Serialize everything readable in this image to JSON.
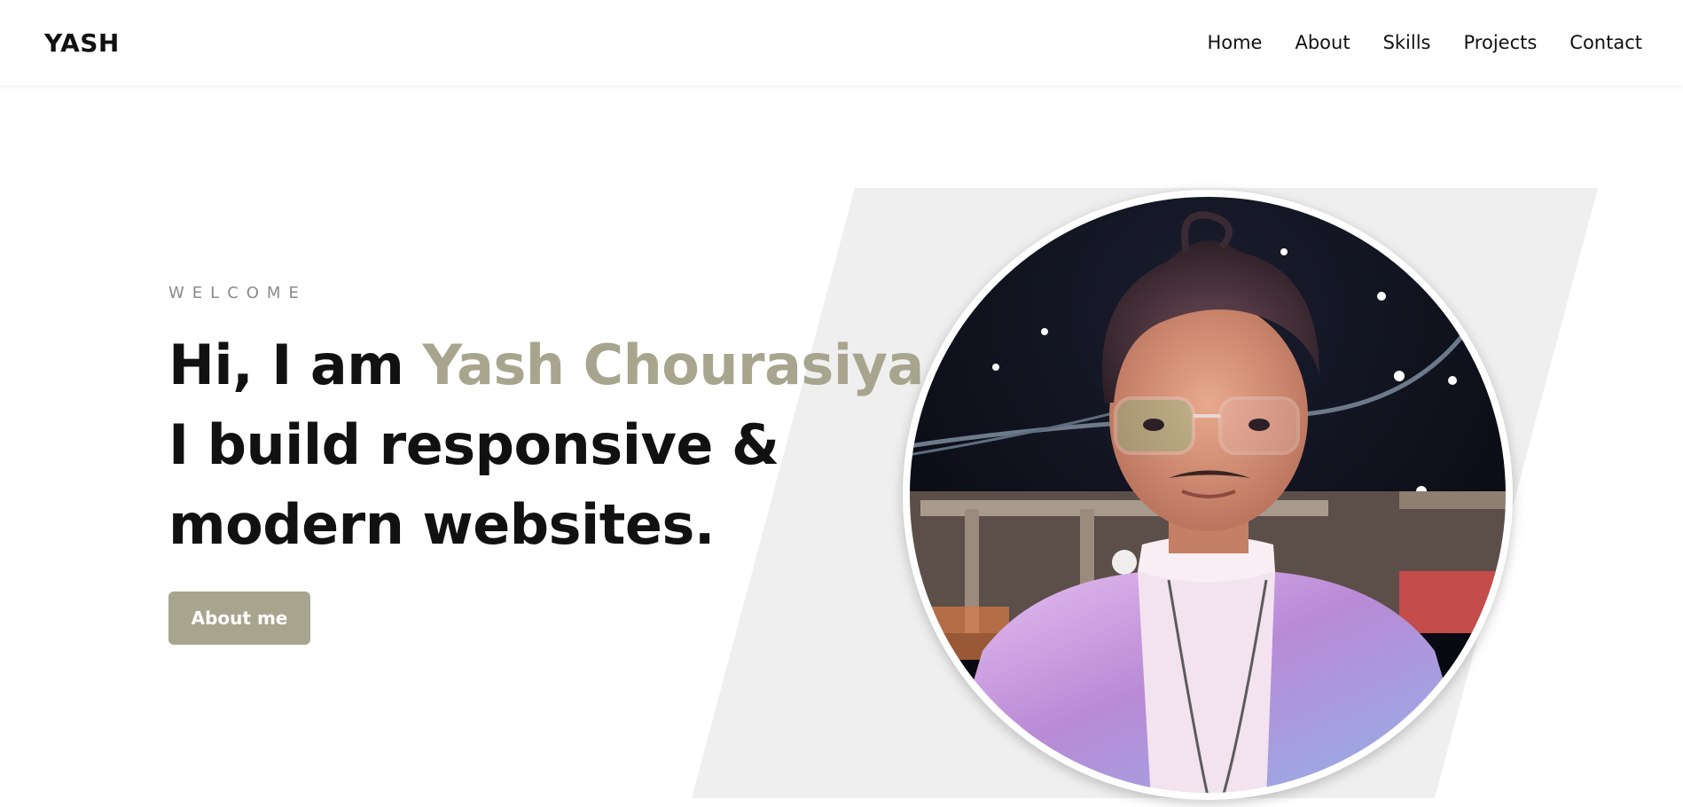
{
  "brand": {
    "logo": "YASH"
  },
  "nav": {
    "items": [
      {
        "label": "Home"
      },
      {
        "label": "About"
      },
      {
        "label": "Skills"
      },
      {
        "label": "Projects"
      },
      {
        "label": "Contact"
      }
    ]
  },
  "hero": {
    "eyebrow": "WELCOME",
    "greeting": "Hi, I am ",
    "name": "Yash Chourasiya",
    "line2": "I build responsive &",
    "line3": "modern websites.",
    "cta_label": "About me",
    "portrait_icon": "profile-photo"
  },
  "colors": {
    "accent": "#a8a58e",
    "text": "#111111",
    "muted": "#8a8a8a",
    "shape": "#efefef"
  }
}
